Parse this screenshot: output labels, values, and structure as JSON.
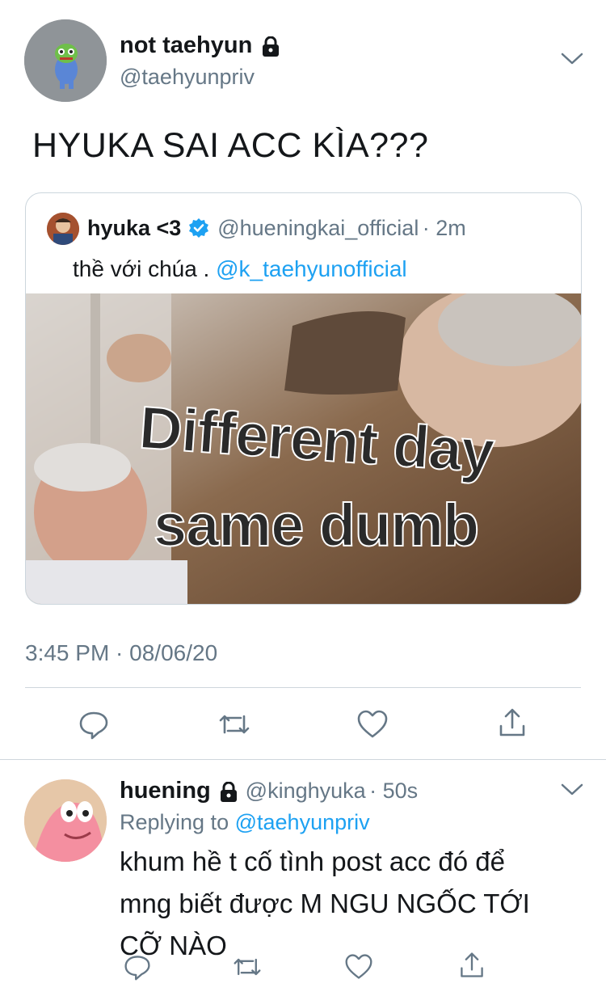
{
  "main_tweet": {
    "display_name": "not taehyun",
    "handle": "@taehyunpriv",
    "text": "HYUKA SAI ACC KÌA???",
    "timestamp": "3:45 PM · 08/06/20"
  },
  "quoted_tweet": {
    "display_name": "hyuka <3",
    "handle": "@hueningkai_official",
    "time_ago": "· 2m",
    "text": "thề với chúa  .",
    "mention": "@k_taehyunofficial",
    "meme_line1": "Different day",
    "meme_line2": "same dumb"
  },
  "reply_tweet": {
    "display_name": "huening",
    "handle": "@kinghyuka",
    "time_ago": "· 50s",
    "replying_prefix": "Replying to",
    "replying_to": "@taehyunpriv",
    "text_line1": "khum hề t cố tình post acc đó để",
    "text_line2": "mng biết được M NGU NGỐC TỚI",
    "text_line3": "CỠ NÀO"
  },
  "icons": [
    "lock-icon",
    "chevron-down-icon",
    "verified-badge-icon",
    "reply-icon",
    "retweet-icon",
    "like-icon",
    "share-icon"
  ],
  "colors": {
    "accent": "#1da1f2",
    "secondary_text": "#657786",
    "divider": "#cfd6dc"
  }
}
